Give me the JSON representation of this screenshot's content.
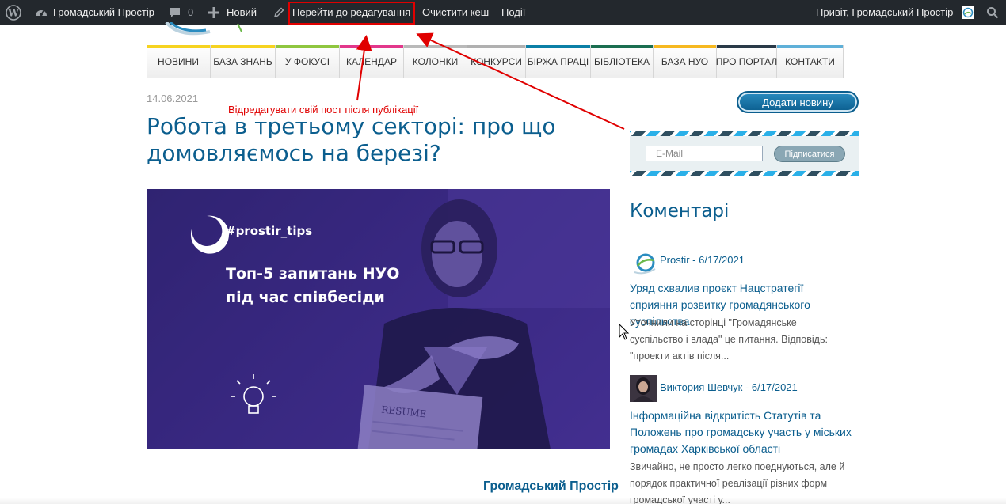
{
  "adminbar": {
    "site_name": "Громадський Простір",
    "comments_count": "0",
    "new_label": "Новий",
    "edit_label": "Перейти до редагування",
    "clear_cache_label": "Очистити кеш",
    "events_label": "Події",
    "greeting": "Привіт, Громадський Простір"
  },
  "nav": {
    "items": [
      {
        "label": "НОВИНИ",
        "color": "#f6d320"
      },
      {
        "label": "БАЗА ЗНАНЬ",
        "color": "#f6d320"
      },
      {
        "label": "У ФОКУСІ",
        "color": "#8fc63f"
      },
      {
        "label": "КАЛЕНДАР",
        "color": "#e2378b"
      },
      {
        "label": "КОЛОНКИ",
        "color": "#b9b9b9"
      },
      {
        "label": "КОНКУРСИ",
        "color": "#b0b0b0"
      },
      {
        "label": "БІРЖА ПРАЦІ",
        "color": "#0b7fa6"
      },
      {
        "label": "БІБЛІОТЕКА",
        "color": "#1a6e50"
      },
      {
        "label": "БАЗА НУО",
        "color": "#f6b820"
      },
      {
        "label": "ПРО ПОРТАЛ",
        "color": "#2a3a48"
      },
      {
        "label": "КОНТАКТИ",
        "color": "#5fb0d8"
      }
    ]
  },
  "annotation": {
    "hint": "Відредагувати свій пост після публікації"
  },
  "post": {
    "date": "14.06.2021",
    "title": "Робота в третьому секторі: про що домовляємось на березі?",
    "image": {
      "tag": "#prostir_tips",
      "line1": "Топ-5 запитань НУО",
      "line2": "під час співбесіди",
      "paper_text": "RESUME"
    },
    "author": "Громадський Простір"
  },
  "sidebar": {
    "add_news": "Додати новину",
    "email_placeholder": "E-Mail",
    "subscribe": "Підписатися",
    "comments_heading": "Коментарі",
    "comments": [
      {
        "meta": "Prostir - 6/17/2021",
        "title": "Уряд схвалив проєкт Нацстратегії сприяння розвитку громадянського суспільства",
        "excerpt": "Уточнили на сторінці \"Громадянське суспільство і влада\" це питання. Відповідь: \"проекти актів після..."
      },
      {
        "meta": "Виктория Шевчук - 6/17/2021",
        "title": "Інформаційна відкритість Статутів та Положень про громадську участь у міських громадах Харківської області",
        "excerpt": "Звичайно, не просто легко поеднуються, але й порядок практичної реалізації різних форм громадської участі у..."
      }
    ]
  }
}
